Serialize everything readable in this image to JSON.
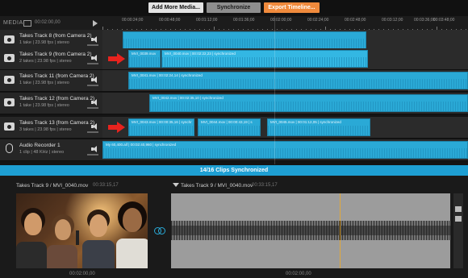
{
  "toolbar": {
    "add_media": "Add More Media...",
    "synchronize": "Synchronize",
    "export": "Export Timeline..."
  },
  "ruler": {
    "media_label": "MEDIA",
    "time": "00:02:00,00",
    "ticks": [
      "00:00:24;00",
      "00:00:48;00",
      "00:01:12;00",
      "00:01:36;00",
      "00:02:00;00",
      "00:02:24;00",
      "00:02:48;00",
      "00:03:12;00",
      "00:03:36;00",
      "00:03:48;00"
    ]
  },
  "tracks": [
    {
      "title": "Takes Track 8 (from Camera 2)",
      "sub": "1 take  |  23.98 fps  |  stereo",
      "icon": "camera-icon",
      "clips": [
        {
          "text": "",
          "selected": false
        }
      ]
    },
    {
      "title": "Takes Track 9 (from Camera 2)",
      "sub": "2 takes  |  23.98 fps  |  stereo",
      "icon": "camera-icon",
      "clips": [
        {
          "text": "MVI_0039.mov",
          "selected": false
        },
        {
          "text": "MVI_0040.mov  |  00:02:22,23  |  synchronized",
          "selected": true
        }
      ]
    },
    {
      "title": "Takes Track 11 (from Camera 2)",
      "sub": "1 take  |  23.98 fps  |  stereo",
      "icon": "camera-icon",
      "clips": [
        {
          "text": "MVI_0041.mov  |  00:02:24,14  |  synchronized",
          "selected": false
        }
      ]
    },
    {
      "title": "Takes Track 12 (from Camera 2)",
      "sub": "1 take  |  23.98 fps  |  stereo",
      "icon": "camera-icon",
      "clips": [
        {
          "text": "MVI_0042.mov  |  00:02:35,10  |  synchronized",
          "selected": false
        }
      ]
    },
    {
      "title": "Takes Track 13 (from Camera 2)",
      "sub": "3 takes  |  23.98 fps  |  stereo",
      "icon": "camera-icon",
      "clips": [
        {
          "text": "MVI_0043.mov  |  00:00:35,16  |  synchr",
          "selected": false
        },
        {
          "text": "MVI_0044.mov  |  00:00:43,19  |  s",
          "selected": false
        },
        {
          "text": "MVI_0045.mov  |  00:01:12,05  |  synchronized",
          "selected": false
        }
      ]
    },
    {
      "title": "Audio Recorder 1",
      "sub": "1 clip  |  48 KHz  |  stereo",
      "icon": "mic-icon",
      "clips": [
        {
          "text": "My 60,400.aif  |  00:02:40,960  |  synchronized",
          "selected": false
        }
      ]
    }
  ],
  "status": "14/16 Clips Synchronized",
  "preview_left": {
    "title": "Takes Track 9 / MVI_0040.mov",
    "time": "00:33:15,17",
    "bottom_time": "00:02:00,00"
  },
  "preview_right": {
    "title": "Takes Track 9 / MVI_0040.mov",
    "time": "00:33:15,17",
    "bottom_time": "00:02:00,00"
  },
  "colors": {
    "accent": "#1e9fd3",
    "clip": "#2aa9d6",
    "arrow": "#e8231e",
    "export": "#f08a3c"
  }
}
